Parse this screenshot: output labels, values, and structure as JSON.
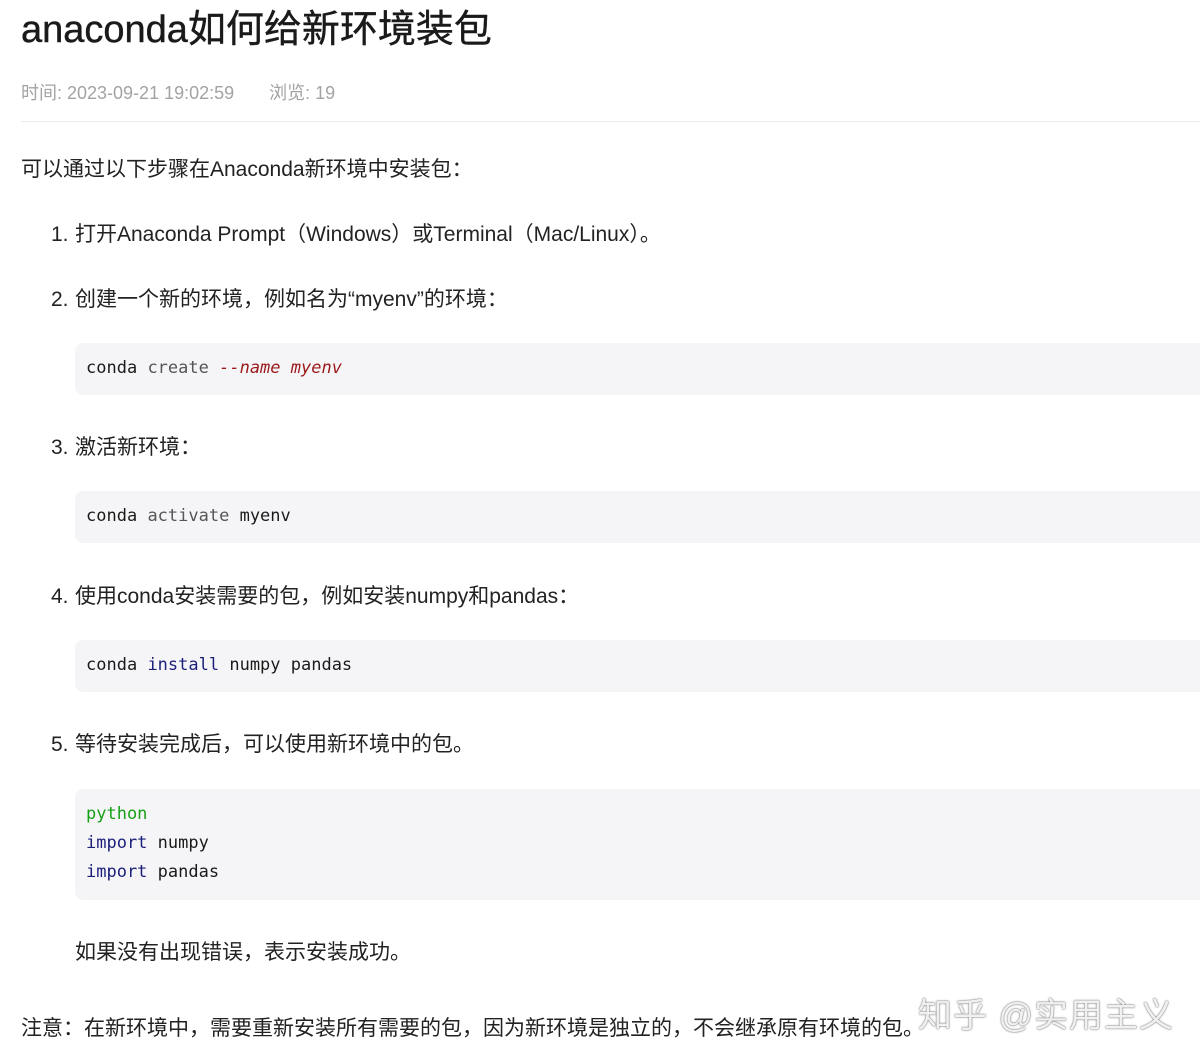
{
  "article": {
    "title": "anaconda如何给新环境装包",
    "meta": {
      "time": "时间: 2023-09-21 19:02:59",
      "views": "浏览: 19"
    },
    "intro": "可以通过以下步骤在Anaconda新环境中安装包：",
    "steps": [
      {
        "num": "1.",
        "text": "打开Anaconda Prompt（Windows）或Terminal（Mac/Linux）。"
      },
      {
        "num": "2.",
        "text": "创建一个新的环境，例如名为“myenv”的环境："
      },
      {
        "num": "3.",
        "text": "激活新环境："
      },
      {
        "num": "4.",
        "text": "使用conda安装需要的包，例如安装numpy和pandas："
      },
      {
        "num": "5.",
        "text": "等待安装完成后，可以使用新环境中的包。"
      }
    ],
    "code_blocks": [
      {
        "tokens": [
          "conda",
          "create",
          "--name",
          "myenv"
        ]
      },
      {
        "tokens": [
          "conda",
          "activate",
          "myenv"
        ]
      },
      {
        "tokens": [
          "conda",
          "install",
          "numpy pandas"
        ]
      },
      {
        "lines": [
          {
            "tokens": [
              "python"
            ]
          },
          {
            "tokens": [
              "import",
              "numpy"
            ]
          },
          {
            "tokens": [
              "import",
              "pandas"
            ]
          }
        ]
      }
    ],
    "success_note": "如果没有出现错误，表示安装成功。",
    "note": "注意：在新环境中，需要重新安装所有需要的包，因为新环境是独立的，不会继承原有环境的包。"
  },
  "watermark": "知乎 @实用主义",
  "colors": {
    "meta_text": "#a3a3a3",
    "code_bg": "#f5f5f7",
    "code_param": "#9a1a1a",
    "code_keyword": "#1b1f7a",
    "code_green": "#17a017"
  }
}
